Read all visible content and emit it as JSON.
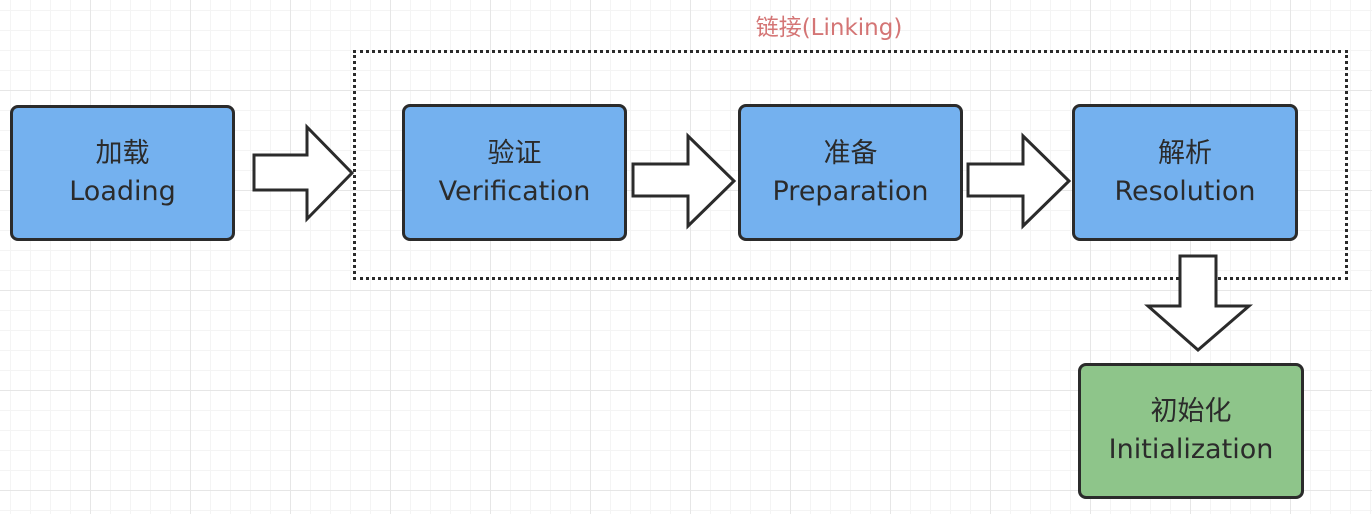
{
  "colors": {
    "phase_box_fill": "#74b1ef",
    "init_box_fill": "#8ec58a",
    "group_label": "#d47575",
    "outline": "#2b2b2b"
  },
  "linking_group": {
    "label": "链接(Linking)"
  },
  "stages": {
    "loading": {
      "zh": "加载",
      "en": "Loading"
    },
    "verification": {
      "zh": "验证",
      "en": "Verification"
    },
    "preparation": {
      "zh": "准备",
      "en": "Preparation"
    },
    "resolution": {
      "zh": "解析",
      "en": "Resolution"
    },
    "initialization": {
      "zh": "初始化",
      "en": "Initialization"
    }
  },
  "arrows": [
    {
      "from": "loading",
      "to": "linking"
    },
    {
      "from": "verification",
      "to": "preparation"
    },
    {
      "from": "preparation",
      "to": "resolution"
    },
    {
      "from": "resolution",
      "to": "initialization"
    }
  ]
}
